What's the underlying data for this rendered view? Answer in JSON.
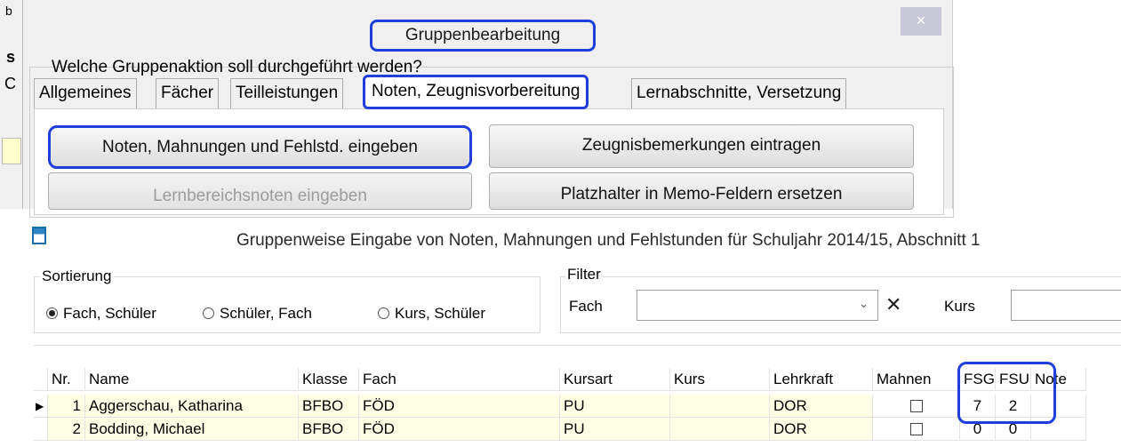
{
  "dialog": {
    "title": "Gruppenbearbeitung",
    "close_glyph": "×",
    "question": "Welche Gruppenaktion soll durchgeführt werden?",
    "left_strip_letters": [
      "b",
      "s",
      "C"
    ],
    "tabs": [
      {
        "label": "Allgemeines"
      },
      {
        "label": "Fächer"
      },
      {
        "label": "Teilleistungen"
      },
      {
        "label": "Noten, Zeugnisvorbereitung"
      },
      {
        "label": "Lernabschnitte, Versetzung"
      }
    ],
    "buttons": {
      "noten": "Noten, Mahnungen und Fehlstd. eingeben",
      "zeugnis": "Zeugnisbemerkungen eintragen",
      "lernbereich": "Lernbereichsnoten eingeben",
      "platzhalter": "Platzhalter in Memo-Feldern ersetzen"
    },
    "highlight_color": "#1f3fdc"
  },
  "window": {
    "title": "Gruppenweise Eingabe von Noten, Mahnungen und Fehlstunden für Schuljahr 2014/15, Abschnitt 1",
    "sort": {
      "label": "Sortierung",
      "options": [
        "Fach, Schüler",
        "Schüler, Fach",
        "Kurs, Schüler"
      ],
      "selected": "Fach, Schüler"
    },
    "filter": {
      "label": "Filter",
      "fach_label": "Fach",
      "fach_value": "",
      "clear_glyph": "✕",
      "kurs_label": "Kurs",
      "kurs_value": ""
    },
    "grid": {
      "headers": {
        "nr": "Nr.",
        "name": "Name",
        "klasse": "Klasse",
        "fach": "Fach",
        "kursart": "Kursart",
        "kurs": "Kurs",
        "lehrkraft": "Lehrkraft",
        "mahnen": "Mahnen",
        "fsg": "FSG",
        "fsu": "FSU",
        "note": "Note"
      },
      "rows": [
        {
          "nr": "1",
          "name": "Aggerschau, Katharina",
          "klasse": "BFBO",
          "fach": "FÖD",
          "kursart": "PU",
          "kurs": "",
          "lehrkraft": "DOR",
          "fsg": "7",
          "fsu": "2",
          "note": "",
          "current": true
        },
        {
          "nr": "2",
          "name": "Bodding, Michael",
          "klasse": "BFBO",
          "fach": "FÖD",
          "kursart": "PU",
          "kurs": "",
          "lehrkraft": "DOR",
          "fsg": "0",
          "fsu": "0",
          "note": "",
          "current": false
        }
      ],
      "row_marker_glyph": "▶"
    }
  }
}
